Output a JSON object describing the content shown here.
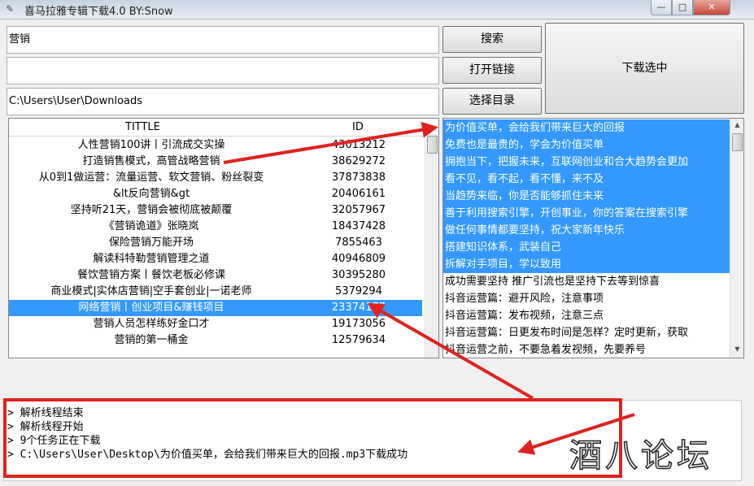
{
  "window": {
    "title": "喜马拉雅专辑下载4.0 BY:Snow",
    "min": "—",
    "max": "□",
    "close": "✕"
  },
  "inputs": {
    "search_value": "营销",
    "link_value": "",
    "dir_value": "C:\\Users\\User\\Downloads"
  },
  "buttons": {
    "search": "搜索",
    "open_link": "打开链接",
    "choose_dir": "选择目录",
    "download_selected": "下载选中"
  },
  "album_list": {
    "headers": {
      "title": "TITTLE",
      "id": "ID"
    },
    "rows": [
      {
        "title": "人性营销100讲丨引流成交实操",
        "id": "43013212"
      },
      {
        "title": "打造销售模式，高管战略营销",
        "id": "38629272"
      },
      {
        "title": "从0到1做运营：流量运营、软文营销、粉丝裂变",
        "id": "37873838"
      },
      {
        "title": "&lt反向营销&gt",
        "id": "20406161"
      },
      {
        "title": "坚持听21天，营销会被彻底被颠覆",
        "id": "32057967"
      },
      {
        "title": "《营销诡道》张晓岚",
        "id": "18437428"
      },
      {
        "title": "保险营销万能开场",
        "id": "7855463"
      },
      {
        "title": "解读科特勒营销管理之道",
        "id": "40946809"
      },
      {
        "title": "餐饮营销方案丨餐饮老板必修课",
        "id": "30395280"
      },
      {
        "title": "商业模式|实体店营销|空手套创业|一诺老师",
        "id": "5379294"
      },
      {
        "title": "网络营销丨创业项目&赚钱项目",
        "id": "23374177"
      },
      {
        "title": "营销人员怎样练好金口才",
        "id": "19173056"
      },
      {
        "title": "营销的第一桶金",
        "id": "12579634"
      }
    ],
    "selected_index": 10
  },
  "track_list": {
    "rows": [
      {
        "text": "为价值买单，会给我们带来巨大的回报",
        "selected": true
      },
      {
        "text": "免费也是最贵的，学会为价值买单",
        "selected": true
      },
      {
        "text": "拥抱当下，把握未来，互联网创业和合大趋势会更加",
        "selected": true
      },
      {
        "text": "看不见，看不起，看不懂，来不及",
        "selected": true
      },
      {
        "text": "当趋势来临，你是否能够抓住未来",
        "selected": true
      },
      {
        "text": "善于利用搜索引擎，开创事业，你的答案在搜索引擎",
        "selected": true
      },
      {
        "text": "做任何事情都要坚持，祝大家新年快乐",
        "selected": true
      },
      {
        "text": "搭建知识体系，武装自己",
        "selected": true
      },
      {
        "text": "拆解对手项目，学以致用",
        "selected": true
      },
      {
        "text": "成功需要坚持 推广引流也是坚持下去等到惊喜",
        "selected": false
      },
      {
        "text": "抖音运营篇：避开风险，注意事项",
        "selected": false
      },
      {
        "text": "抖音运营篇：发布视频，注意三点",
        "selected": false
      },
      {
        "text": "抖音运营篇：日更发布时间是怎样？定时更新，获取",
        "selected": false
      },
      {
        "text": "抖音运营之前，不要急着发视频，先要养号",
        "selected": false
      }
    ]
  },
  "log": {
    "lines": [
      "> 解析线程结束",
      "> 解析线程开始",
      "> 9个任务正在下载",
      "> C:\\Users\\User\\Desktop\\为价值买单，会给我们带来巨大的回报.mp3下载成功"
    ]
  },
  "watermark": "酒八论坛",
  "colors": {
    "selection": "#3399ff",
    "annotation_red": "#e0221e"
  }
}
